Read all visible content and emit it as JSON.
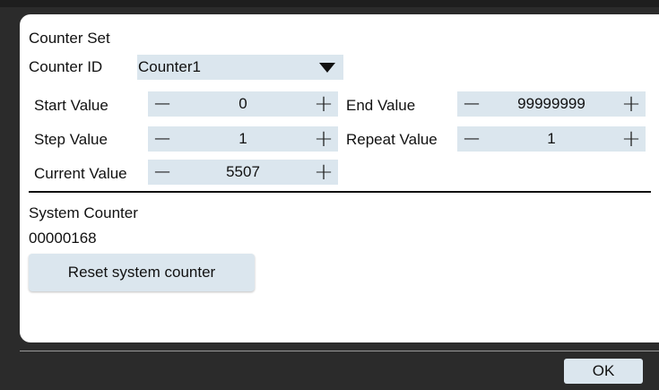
{
  "dialog": {
    "section_title": "Counter Set",
    "counter_id_label": "Counter ID",
    "counter_id_value": "Counter1",
    "start": {
      "label": "Start Value",
      "value": "0"
    },
    "end": {
      "label": "End Value",
      "value": "99999999"
    },
    "step": {
      "label": "Step Value",
      "value": "1"
    },
    "repeat": {
      "label": "Repeat Value",
      "value": "1"
    },
    "current": {
      "label": "Current Value",
      "value": "5507"
    },
    "stepper_minus": "−",
    "stepper_plus": "+",
    "system_counter_title": "System Counter",
    "system_counter_value": "00000168",
    "reset_button": "Reset system counter"
  },
  "footer": {
    "ok_button": "OK"
  },
  "colors": {
    "field_bg": "#dbe6ee",
    "panel_bg": "#ffffff",
    "frame_bg": "#2b2b2b"
  }
}
